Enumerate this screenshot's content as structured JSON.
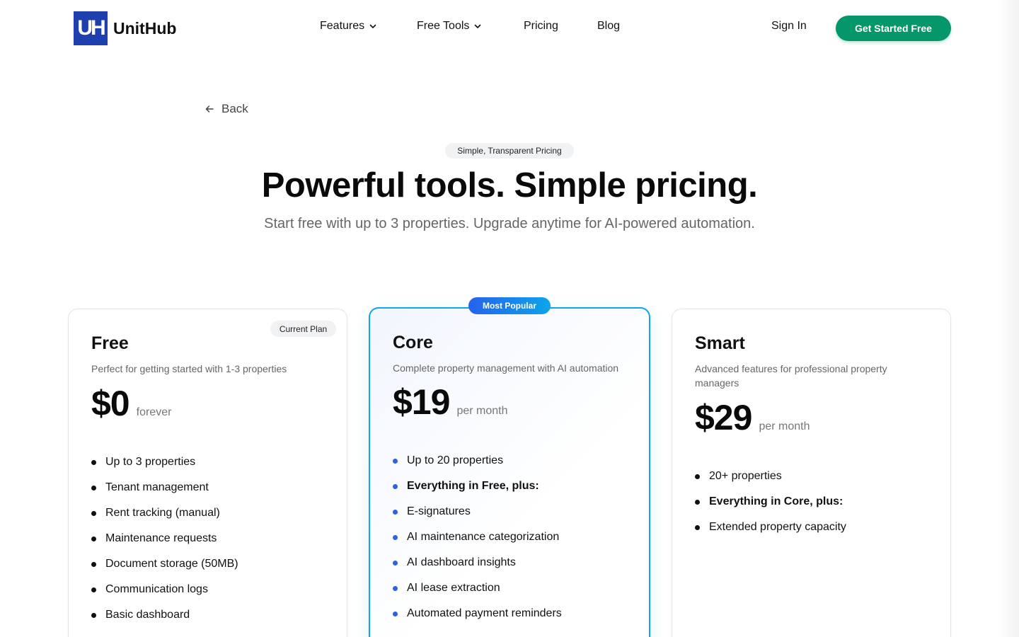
{
  "brand": {
    "mark": "UH",
    "name": "UnitHub",
    "color": "#1e40af"
  },
  "nav": {
    "items": [
      {
        "label": "Features",
        "has_dropdown": true
      },
      {
        "label": "Free Tools",
        "has_dropdown": true
      },
      {
        "label": "Pricing",
        "has_dropdown": false
      },
      {
        "label": "Blog",
        "has_dropdown": false
      }
    ],
    "sign_in": "Sign In",
    "cta": "Get Started Free"
  },
  "back": {
    "label": "Back",
    "icon": "arrow-left-icon"
  },
  "hero": {
    "eyebrow": "Simple, Transparent Pricing",
    "title": "Powerful tools. Simple pricing.",
    "subtitle": "Start free with up to 3 properties. Upgrade anytime for AI-powered automation."
  },
  "plans": [
    {
      "name": "Free",
      "badge": "Current Plan",
      "description": "Perfect for getting started with 1-3 properties",
      "price": "$0",
      "period": "forever",
      "features": [
        {
          "text": "Up to 3 properties",
          "bold": false
        },
        {
          "text": "Tenant management",
          "bold": false
        },
        {
          "text": "Rent tracking (manual)",
          "bold": false
        },
        {
          "text": "Maintenance requests",
          "bold": false
        },
        {
          "text": "Document storage (50MB)",
          "bold": false
        },
        {
          "text": "Communication logs",
          "bold": false
        },
        {
          "text": "Basic dashboard",
          "bold": false
        }
      ]
    },
    {
      "name": "Core",
      "badge": "Most Popular",
      "description": "Complete property management with AI automation",
      "price": "$19",
      "period": "per month",
      "features": [
        {
          "text": "Up to 20 properties",
          "bold": false
        },
        {
          "text": "Everything in Free, plus:",
          "bold": true
        },
        {
          "text": "E-signatures",
          "bold": false
        },
        {
          "text": "AI maintenance categorization",
          "bold": false
        },
        {
          "text": "AI dashboard insights",
          "bold": false
        },
        {
          "text": "AI lease extraction",
          "bold": false
        },
        {
          "text": "Automated payment reminders",
          "bold": false
        }
      ]
    },
    {
      "name": "Smart",
      "description": "Advanced features for professional property managers",
      "price": "$29",
      "period": "per month",
      "features": [
        {
          "text": "20+ properties",
          "bold": false
        },
        {
          "text": "Everything in Core, plus:",
          "bold": true
        },
        {
          "text": "Extended property capacity",
          "bold": false
        }
      ]
    }
  ],
  "colors": {
    "cta_green": "#059669",
    "accent_blue": "#2563eb",
    "accent_cyan": "#0ea5e9"
  }
}
